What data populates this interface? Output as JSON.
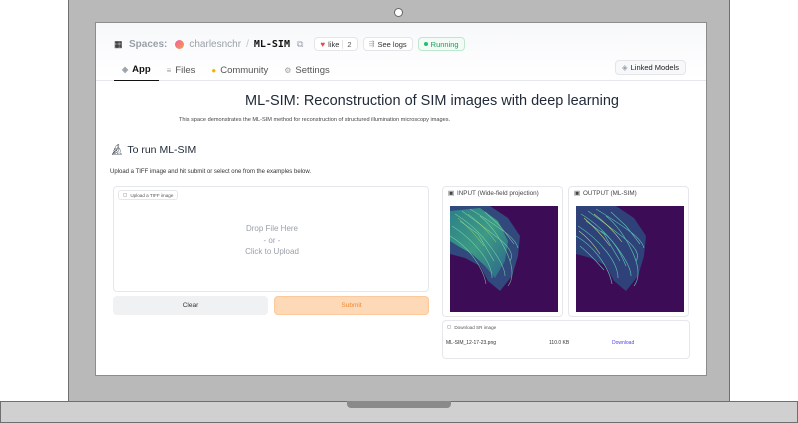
{
  "header": {
    "spaces_label": "Spaces:",
    "owner": "charlesnchr",
    "separator": "/",
    "repo": "ML-SIM",
    "like_label": "like",
    "like_count": "2",
    "see_logs": "See logs",
    "status": "Running",
    "linked_models": "Linked Models"
  },
  "tabs": [
    {
      "label": "App",
      "icon": "app-icon"
    },
    {
      "label": "Files",
      "icon": "files-icon"
    },
    {
      "label": "Community",
      "icon": "community-icon"
    },
    {
      "label": "Settings",
      "icon": "settings-icon"
    }
  ],
  "main": {
    "title": "ML-SIM: Reconstruction of SIM images with deep learning",
    "description": "This space demonstrates the ML-SIM method for reconstruction of structured illumination microscopy images.",
    "section_heading": "To run ML-SIM",
    "instructions": "Upload a TIFF image and hit submit or select one from the examples below."
  },
  "upload": {
    "label": "Upload a TIFF image",
    "drop_line1": "Drop File Here",
    "drop_line2": "- or -",
    "drop_line3": "Click to Upload"
  },
  "buttons": {
    "clear": "Clear",
    "submit": "Submit"
  },
  "input_panel": {
    "label": "INPUT (Wide-field projection)"
  },
  "output_panel": {
    "label": "OUTPUT (ML-SIM)"
  },
  "download": {
    "label": "Download SR image",
    "filename": "ML-SIM_12-17-23.png",
    "size": "110.0 KB",
    "link": "Download"
  },
  "colors": {
    "accent": "#f08a32",
    "running": "#17a05a",
    "image_bg": "#3d0c57",
    "link": "#4f46e5"
  }
}
